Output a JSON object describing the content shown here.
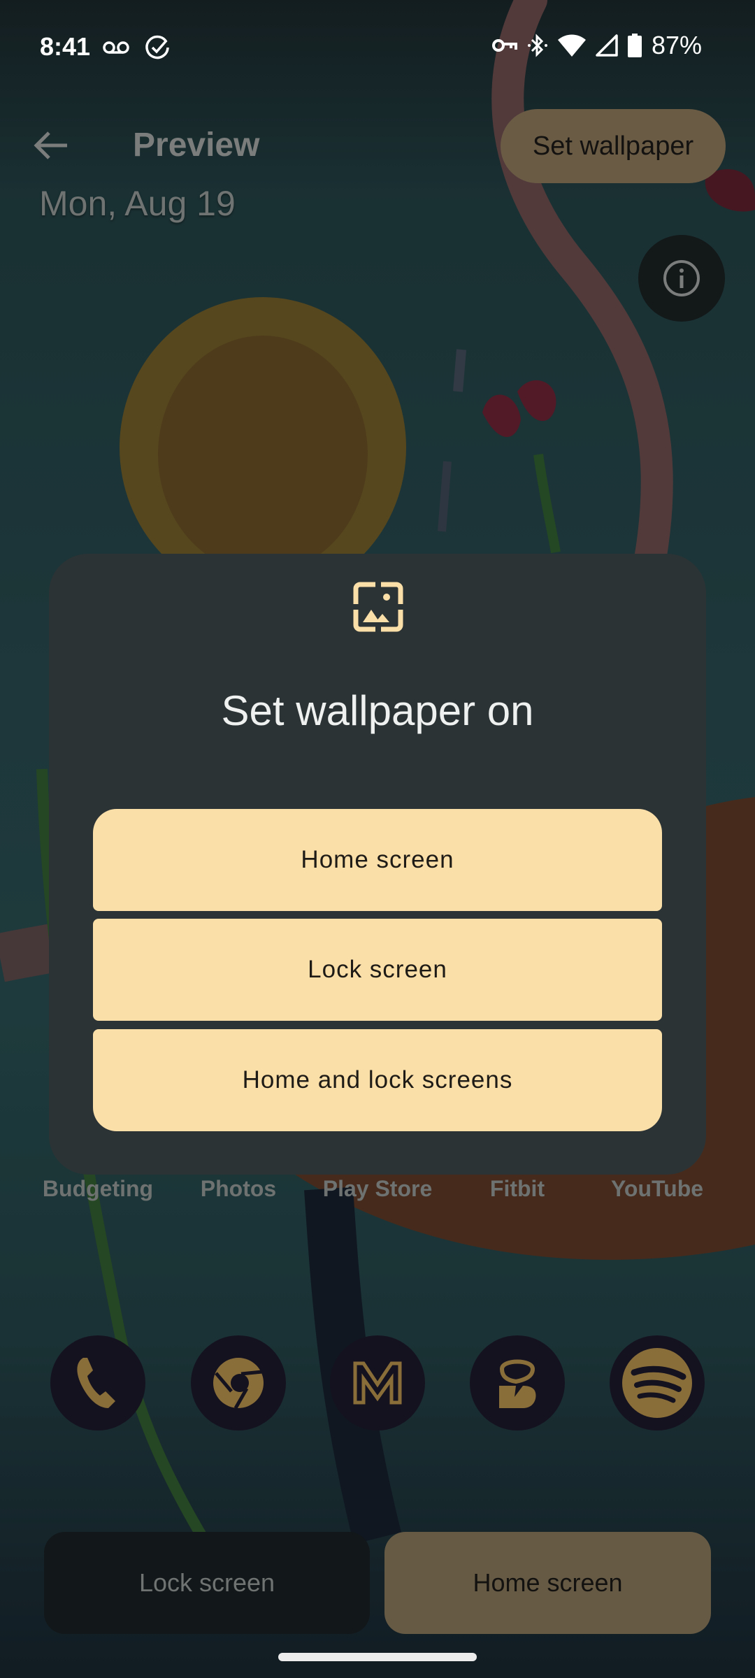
{
  "status_bar": {
    "time": "8:41",
    "left_icons": [
      "voicemail-icon",
      "task-done-icon"
    ],
    "right_icons": [
      "vpn-key-icon",
      "bluetooth-icon",
      "wifi-icon",
      "cellular-signal-icon",
      "battery-icon"
    ],
    "battery_percent": "87%"
  },
  "top_bar": {
    "back_icon": "arrow-left-icon",
    "title": "Preview",
    "set_wallpaper_label": "Set wallpaper",
    "info_icon": "info-icon"
  },
  "preview": {
    "date": "Mon, Aug 19",
    "app_labels": [
      "Budgeting",
      "Photos",
      "Play Store",
      "Fitbit",
      "YouTube"
    ],
    "dock_icons": [
      "phone-icon",
      "chrome-icon",
      "gmail-icon",
      "messages-icon",
      "spotify-icon"
    ]
  },
  "dialog": {
    "icon": "wallpaper-icon",
    "title": "Set wallpaper on",
    "options": [
      {
        "label": "Home screen"
      },
      {
        "label": "Lock screen"
      },
      {
        "label": "Home and lock screens"
      }
    ]
  },
  "bottom_tabs": {
    "lock_label": "Lock screen",
    "home_label": "Home screen",
    "selected": "Home screen"
  },
  "colors": {
    "dialog_bg": "#2c3335",
    "option_bg": "#fbdfa9",
    "accent_icon": "#fbdfa9",
    "set_wallpaper_bg": "#6a5b45",
    "dock_icon_fg": "#8a6e3a"
  }
}
